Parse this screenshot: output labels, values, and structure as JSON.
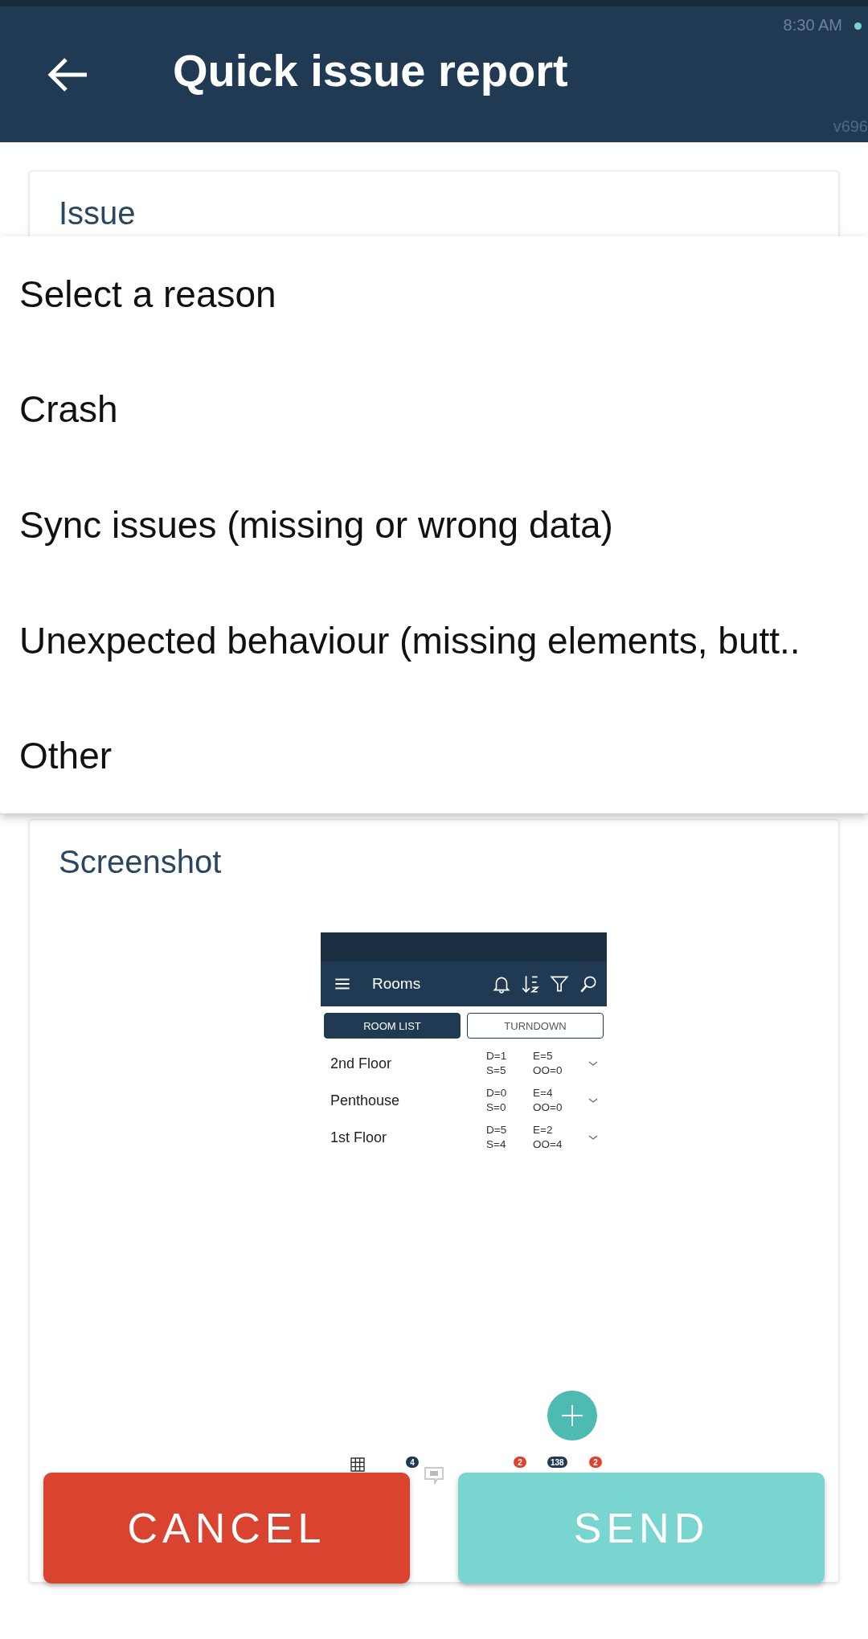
{
  "status_bar": {
    "time": "8:30 AM",
    "version": "v696"
  },
  "app_bar": {
    "title": "Quick issue report"
  },
  "issue_card": {
    "label": "Issue"
  },
  "reason_menu": {
    "items": [
      "Select a reason",
      "Crash",
      "Sync issues (missing or wrong data)",
      "Unexpected behaviour (missing elements, butt..",
      "Other"
    ]
  },
  "screenshot_card": {
    "label": "Screenshot",
    "thumbnail": {
      "app_bar_title": "Rooms",
      "tabs": [
        {
          "label": "ROOM LIST",
          "selected": true
        },
        {
          "label": "TURNDOWN",
          "selected": false
        }
      ],
      "rows": [
        {
          "name": "2nd Floor",
          "stats": [
            "D=1",
            "E=5",
            "S=5",
            "OO=0"
          ]
        },
        {
          "name": "Penthouse",
          "stats": [
            "D=0",
            "E=4",
            "S=0",
            "OO=0"
          ]
        },
        {
          "name": "1st Floor",
          "stats": [
            "D=5",
            "E=2",
            "S=4",
            "OO=4"
          ]
        }
      ],
      "nav_badges": [
        {
          "text": "4",
          "color": "#1f3a52"
        },
        {
          "text": "2",
          "color": "#d9432f"
        },
        {
          "text": "138",
          "color": "#1f3a52"
        },
        {
          "text": "2",
          "color": "#d9432f"
        }
      ]
    }
  },
  "buttons": [
    {
      "label": "CANCEL",
      "kind": "cancel"
    },
    {
      "label": "SEND",
      "kind": "send"
    }
  ]
}
